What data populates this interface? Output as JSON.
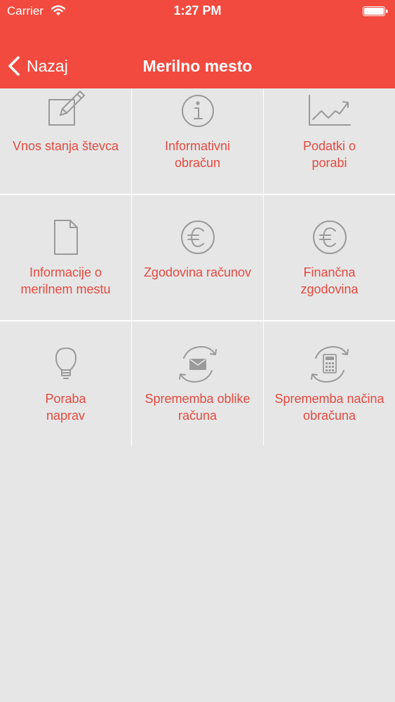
{
  "status_bar": {
    "carrier": "Carrier",
    "time": "1:27 PM",
    "icons": [
      "wifi-icon",
      "battery-icon"
    ]
  },
  "nav": {
    "back_label": "Nazaj",
    "title": "Merilno mesto"
  },
  "colors": {
    "header": "#f24a3e",
    "label": "#e44a40",
    "background": "#e6e6e6",
    "icon": "#9a9a9a"
  },
  "tiles": [
    {
      "label": "Vnos stanja števca",
      "icon": "edit-icon"
    },
    {
      "label": "Informativni\nobračun",
      "icon": "info-icon"
    },
    {
      "label": "Podatki o\nporabi",
      "icon": "line-chart-icon"
    },
    {
      "label": "Informacije o\nmerilnem mestu",
      "icon": "document-icon"
    },
    {
      "label": "Zgodovina računov",
      "icon": "euro-icon"
    },
    {
      "label": "Finančna\nzgodovina",
      "icon": "euro-icon"
    },
    {
      "label": "Poraba\nnaprav",
      "icon": "lightbulb-icon"
    },
    {
      "label": "Sprememba oblike\nračuna",
      "icon": "envelope-refresh-icon"
    },
    {
      "label": "Sprememba načina\nobračuna",
      "icon": "calculator-refresh-icon"
    }
  ]
}
